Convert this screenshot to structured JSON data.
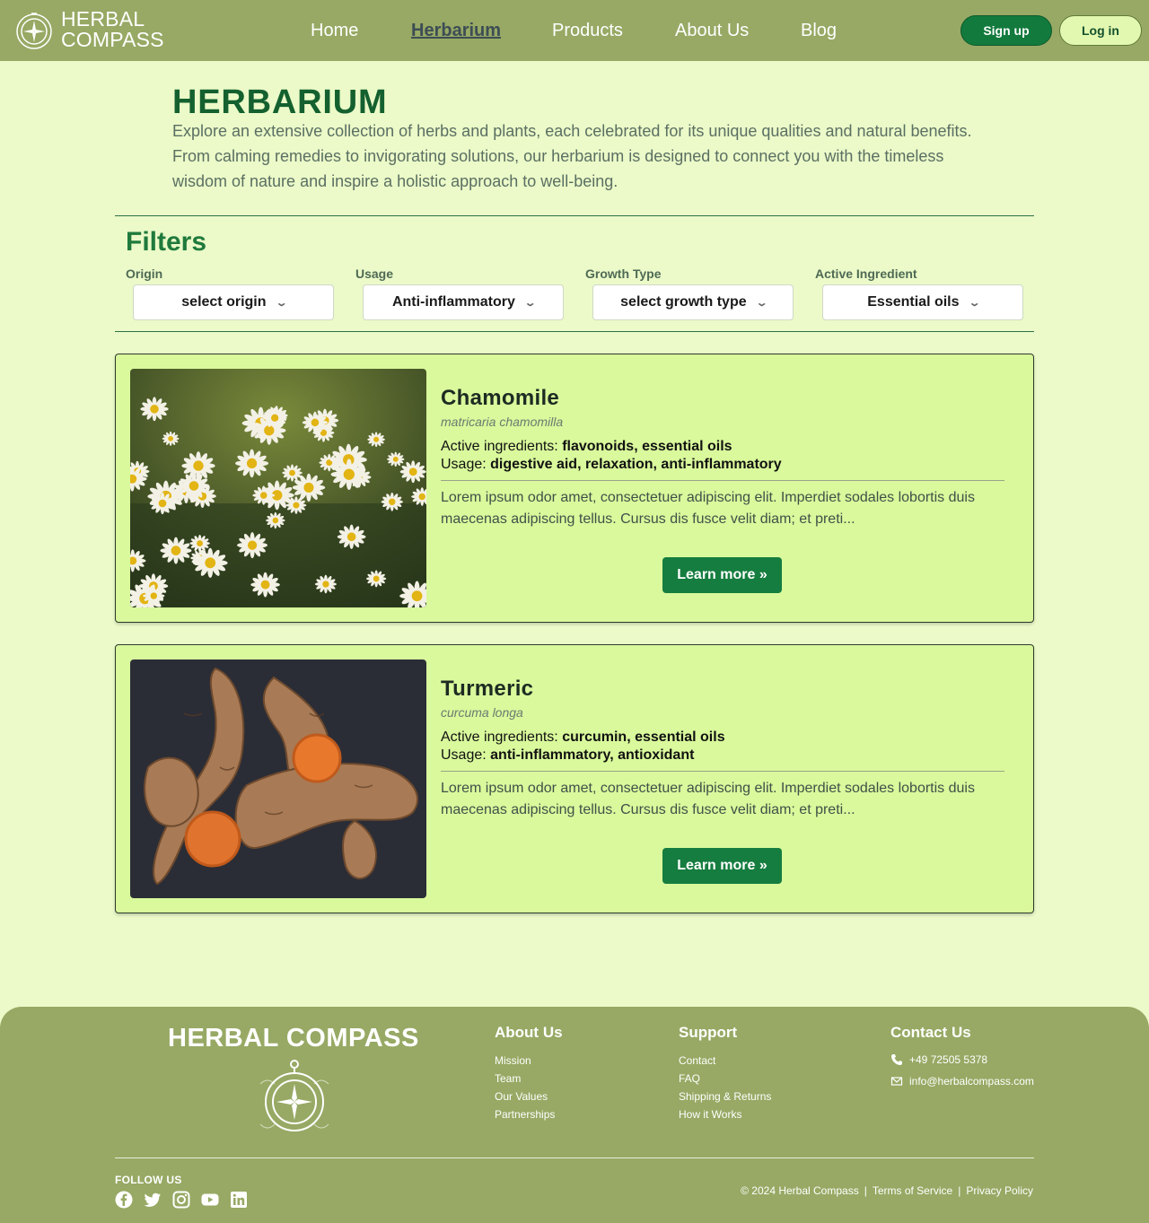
{
  "brand": {
    "name_line1": "HERBAL",
    "name_line2": "COMPASS",
    "icon": "compass-logo-icon"
  },
  "nav": {
    "items": [
      {
        "label": "Home",
        "active": false
      },
      {
        "label": "Herbarium",
        "active": true
      },
      {
        "label": "Products",
        "active": false
      },
      {
        "label": "About Us",
        "active": false
      },
      {
        "label": "Blog",
        "active": false
      }
    ]
  },
  "auth": {
    "signup_label": "Sign up",
    "login_label": "Log in"
  },
  "hero": {
    "title": "HERBARIUM",
    "description": "Explore an extensive collection of herbs and plants, each celebrated for its unique qualities and natural benefits. From calming remedies to invigorating solutions, our herbarium is designed to connect you with the timeless wisdom of nature and inspire a holistic approach to well-being."
  },
  "filters": {
    "title": "Filters",
    "items": [
      {
        "label": "Origin",
        "value": "select origin"
      },
      {
        "label": "Usage",
        "value": "Anti-inflammatory"
      },
      {
        "label": "Growth Type",
        "value": "select growth type"
      },
      {
        "label": "Active Ingredient",
        "value": "Essential oils"
      }
    ]
  },
  "herbs": [
    {
      "name": "Chamomile",
      "latin": "matricaria chamomilla",
      "ingredients_label": "Active ingredients: ",
      "ingredients": "flavonoids, essential oils",
      "usage_label": "Usage: ",
      "usage": "digestive aid, relaxation, anti-inflammatory",
      "description": "Lorem ipsum odor amet, consectetuer adipiscing elit. Imperdiet sodales lobortis duis maecenas adipiscing tellus. Cursus dis fusce velit diam; et preti...",
      "button": "Learn more »",
      "image": "chamomile-flowers-photo"
    },
    {
      "name": "Turmeric",
      "latin": "curcuma longa",
      "ingredients_label": "Active ingredients: ",
      "ingredients": "curcumin, essential oils",
      "usage_label": "Usage: ",
      "usage": "anti-inflammatory, antioxidant",
      "description": "Lorem ipsum odor amet, consectetuer adipiscing elit. Imperdiet sodales lobortis duis maecenas adipiscing tellus. Cursus dis fusce velit diam; et preti...",
      "button": "Learn more »",
      "image": "turmeric-roots-photo"
    }
  ],
  "footer": {
    "brand": "HERBAL COMPASS",
    "about": {
      "title": "About Us",
      "links": [
        "Mission",
        "Team",
        "Our Values",
        "Partnerships"
      ]
    },
    "support": {
      "title": "Support",
      "links": [
        "Contact",
        "FAQ",
        "Shipping & Returns",
        "How it Works"
      ]
    },
    "contact": {
      "title": "Contact Us",
      "phone": "+49 72505 5378",
      "email": "info@herbalcompass.com"
    },
    "follow_label": "FOLLOW US",
    "social_icons": [
      "facebook-icon",
      "twitter-icon",
      "instagram-icon",
      "youtube-icon",
      "linkedin-icon"
    ],
    "copyright": "© 2024 Herbal Compass",
    "terms": "Terms of Service",
    "privacy": "Privacy Policy",
    "separator": "|"
  },
  "colors": {
    "header_bg": "#97a964",
    "page_bg": "#ebfac8",
    "card_bg": "#d9f99c",
    "accent_green": "#157d3f",
    "title_green": "#14602f"
  }
}
